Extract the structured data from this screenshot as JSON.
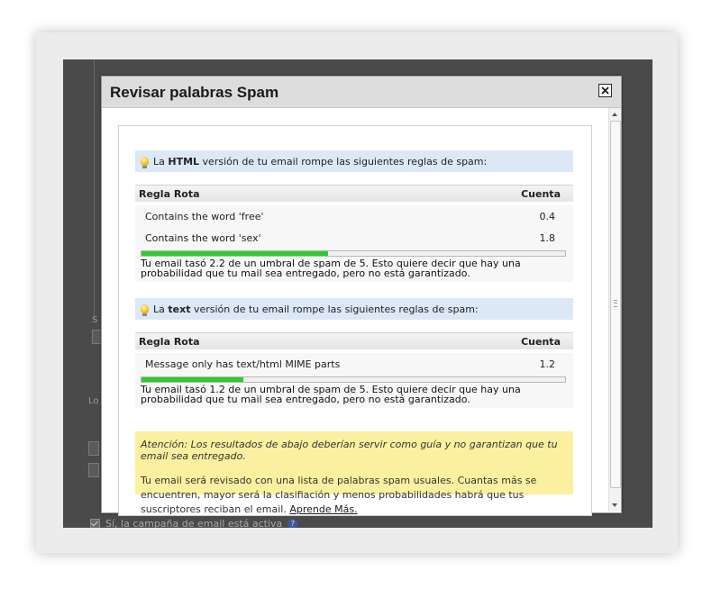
{
  "background": {
    "checkbox_label": "Sí, la campaña de email está activa",
    "fragment_left_1": "S",
    "fragment_left_2": "Lo"
  },
  "modal": {
    "title": "Revisar palabras Spam",
    "close_icon": "close-x-icon"
  },
  "sections": [
    {
      "notice_prefix": "La ",
      "notice_bold": "HTML",
      "notice_suffix": " versión de tu email rompe las siguientes reglas de spam:",
      "columns": [
        "Regla Rota",
        "Cuenta"
      ],
      "rows": [
        {
          "rule": "Contains the word 'free'",
          "count": "0.4"
        },
        {
          "rule": "Contains the word 'sex'",
          "count": "1.8"
        }
      ],
      "score_fraction": 0.44,
      "score_text": "Tu email tasó 2.2 de un umbral de spam de 5. Esto quiere decir que hay una probabilidad que tu mail sea entregado, pero no está garantizado."
    },
    {
      "notice_prefix": "La ",
      "notice_bold": "text",
      "notice_suffix": " versión de tu email rompe las siguientes reglas de spam:",
      "columns": [
        "Regla Rota",
        "Cuenta"
      ],
      "rows": [
        {
          "rule": "Message only has text/html MIME parts",
          "count": "1.2"
        }
      ],
      "score_fraction": 0.24,
      "score_text": "Tu email tasó 1.2 de un umbral de spam de 5. Esto quiere decir que hay una probabilidad que tu mail sea entregado, pero no está garantizado."
    }
  ],
  "warning": {
    "italic": "Atención: Los resultados de abajo deberían servir como guía y no garantizan que tu email sea entregado.",
    "text": "Tu email será revisado con una lista de palabras spam usuales. Cuantas más se encuentren, mayor será la clasifiación y menos probabilidades habrá que tus suscriptores reciban el email.",
    "link": "Aprende Más."
  },
  "colors": {
    "progress_fill": "#2ccc2c",
    "notice_bg": "#dde8f7",
    "warning_bg": "#fbf0a0"
  }
}
